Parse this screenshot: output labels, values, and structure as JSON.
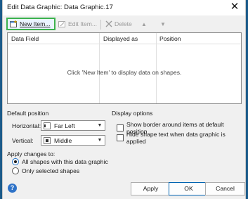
{
  "window": {
    "title": "Edit Data Graphic: Data Graphic.17",
    "close_glyph": "✕"
  },
  "toolbar": {
    "new_item_label": "New Item...",
    "edit_item_label": "Edit Item...",
    "delete_label": "Delete",
    "up_glyph": "▲",
    "down_glyph": "▼"
  },
  "list": {
    "columns": [
      "Data Field",
      "Displayed as",
      "Position"
    ],
    "empty_message": "Click 'New Item' to display data on shapes."
  },
  "default_position": {
    "heading": "Default position",
    "horizontal_label": "Horizontal:",
    "horizontal_value": "Far Left",
    "vertical_label": "Vertical:",
    "vertical_value": "Middle"
  },
  "display_options": {
    "heading": "Display options",
    "show_border_label": "Show border around items at default position",
    "show_border_checked": false,
    "hide_text_label": "Hide shape text when data graphic is applied",
    "hide_text_checked": false
  },
  "apply_changes": {
    "heading": "Apply changes to:",
    "options": [
      {
        "label": "All shapes with this data graphic",
        "selected": true
      },
      {
        "label": "Only selected shapes",
        "selected": false
      }
    ]
  },
  "footer": {
    "help_glyph": "?",
    "apply_label": "Apply",
    "ok_label": "OK",
    "cancel_label": "Cancel"
  }
}
